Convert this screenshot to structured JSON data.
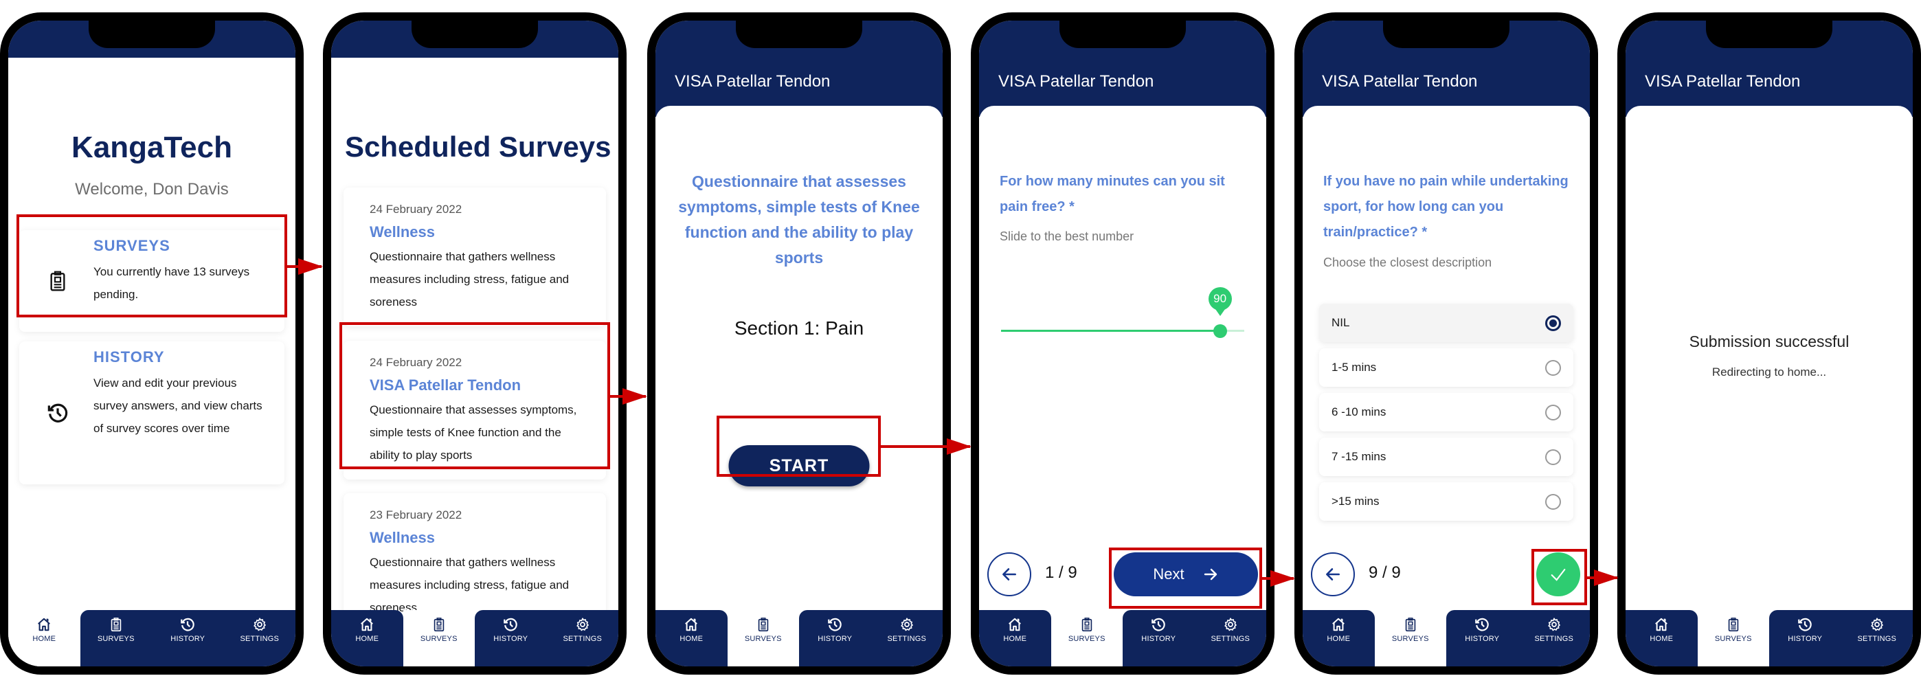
{
  "colors": {
    "navy": "#0f245c",
    "accent_blue": "#5b84d6",
    "button_blue": "#14358c",
    "success_green": "#2ecc71",
    "annotation_red": "#cc0000"
  },
  "nav": {
    "items": [
      {
        "label": "HOME",
        "icon": "home-icon"
      },
      {
        "label": "SURVEYS",
        "icon": "clipboard-icon"
      },
      {
        "label": "HISTORY",
        "icon": "history-icon"
      },
      {
        "label": "SETTINGS",
        "icon": "gear-icon"
      }
    ]
  },
  "screens": {
    "home": {
      "app_title": "KangaTech",
      "welcome": "Welcome, Don Davis",
      "active_tab": "HOME",
      "cards": [
        {
          "title": "SURVEYS",
          "text": "You currently have 13 surveys pending.",
          "icon": "clipboard-icon"
        },
        {
          "title": "HISTORY",
          "text": "View and edit your previous survey answers, and view charts of survey scores over time",
          "icon": "history-icon"
        }
      ]
    },
    "scheduled": {
      "title": "Scheduled Surveys",
      "active_tab": "SURVEYS",
      "surveys": [
        {
          "date": "24 February 2022",
          "name": "Wellness",
          "description": "Questionnaire that gathers wellness measures including stress, fatigue and soreness"
        },
        {
          "date": "24 February 2022",
          "name": "VISA Patellar Tendon",
          "description": "Questionnaire that assesses symptoms, simple tests of Knee function and the ability to play sports"
        },
        {
          "date": "23 February 2022",
          "name": "Wellness",
          "description": "Questionnaire that gathers wellness measures including stress, fatigue and soreness"
        }
      ]
    },
    "intro": {
      "header": "VISA Patellar Tendon",
      "description": "Questionnaire that assesses symptoms, simple tests of Knee function and the ability to play sports",
      "section": "Section 1: Pain",
      "start_label": "START",
      "active_tab": "SURVEYS"
    },
    "question1": {
      "header": "VISA Patellar Tendon",
      "question": "For how many minutes can you sit pain free? *",
      "hint": "Slide to the best number",
      "slider": {
        "value": 90,
        "min": 0,
        "max": 100
      },
      "page": "1 / 9",
      "next_label": "Next",
      "active_tab": "SURVEYS"
    },
    "question9": {
      "header": "VISA Patellar Tendon",
      "question": "If you have no pain while undertaking sport, for how long can you train/practice? *",
      "hint": "Choose the closest description",
      "options": [
        {
          "label": "NIL",
          "selected": true
        },
        {
          "label": "1-5 mins",
          "selected": false
        },
        {
          "label": "6 -10 mins",
          "selected": false
        },
        {
          "label": "7 -15 mins",
          "selected": false
        },
        {
          "label": ">15 mins",
          "selected": false
        }
      ],
      "page": "9 / 9",
      "active_tab": "SURVEYS"
    },
    "done": {
      "header": "VISA Patellar Tendon",
      "message": "Submission successful",
      "sub_message": "Redirecting to home...",
      "active_tab": "SURVEYS"
    }
  }
}
